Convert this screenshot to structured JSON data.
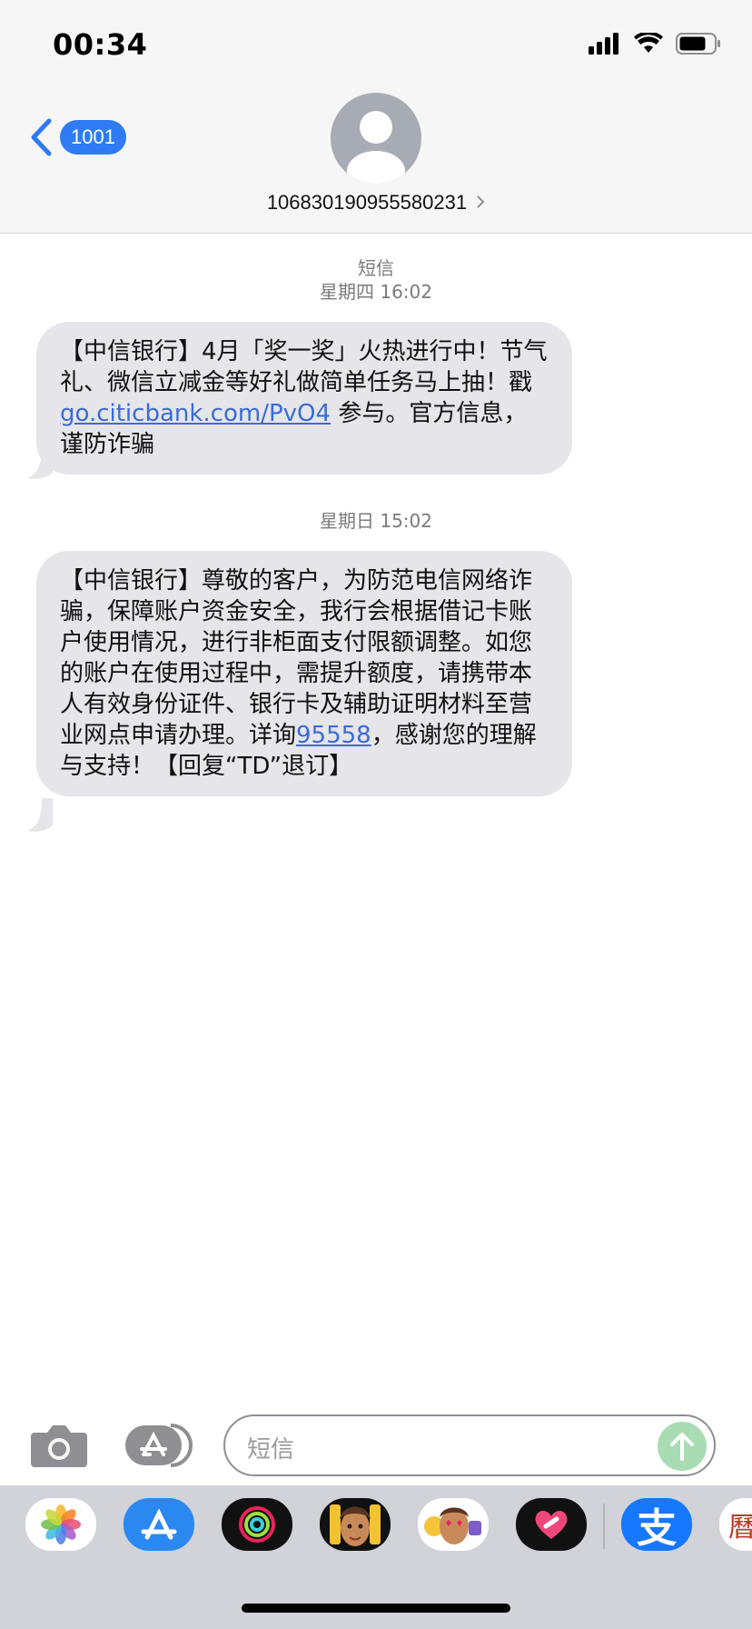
{
  "status": {
    "time": "00:34"
  },
  "nav": {
    "back_badge": "1001",
    "contact": "106830190955580231"
  },
  "messages": {
    "service_label": "短信",
    "ts1": "星期四 16:02",
    "msg1": {
      "p1": "【中信银行】4月「奖一奖」火热进行中！节气礼、微信立减金等好礼做简单任务马上抽！戳 ",
      "link": "go.citicbank.com/PvO4",
      "p2": " 参与。官方信息，谨防诈骗"
    },
    "ts2": "星期日 15:02",
    "msg2": {
      "p1": "【中信银行】尊敬的客户，为防范电信网络诈骗，保障账户资金安全，我行会根据借记卡账户使用情况，进行非柜面支付限额调整。如您的账户在使用过程中，需提升额度，请携带本人有效身份证件、银行卡及辅助证明材料至营业网点申请办理。详询",
      "link": "95558",
      "p2": "，感谢您的理解与支持！【回复“TD”退订】"
    }
  },
  "input": {
    "placeholder": "短信"
  },
  "drawer": {
    "icons": [
      "photos-icon",
      "app-store-icon",
      "activity-icon",
      "memoji-icon",
      "memoji-stickers-icon",
      "digital-touch-icon",
      "alipay-icon",
      "calendar-app-icon"
    ],
    "alipay_char": "支",
    "partial_char": "曆"
  },
  "colors": {
    "accent": "#2f7bf6",
    "bubble": "#e5e5ea",
    "send": "#a9dcb2"
  }
}
